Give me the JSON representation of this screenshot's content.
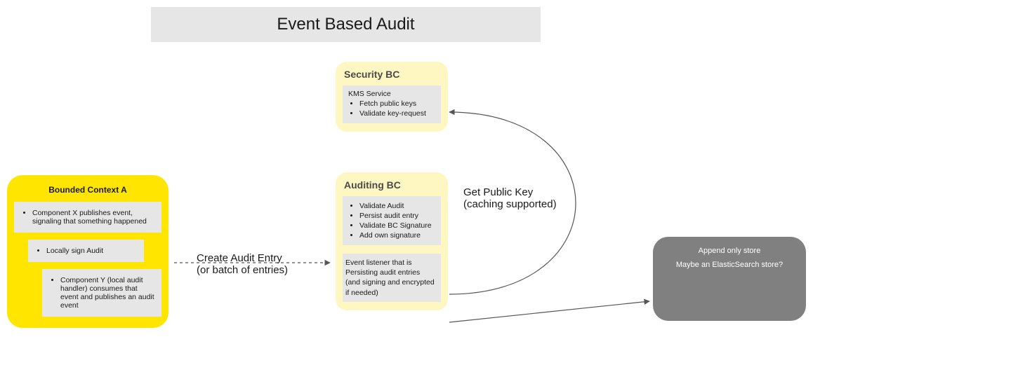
{
  "title": "Event Based Audit",
  "bounded_context_a": {
    "title": "Bounded Context A",
    "note1": "Component X publishes event, signaling that something happened",
    "note2": "Locally sign Audit",
    "note3": "Component Y (local audit handler) consumes that event and publishes an audit event"
  },
  "security_bc": {
    "title": "Security BC",
    "service_title": "KMS Service",
    "items": [
      "Fetch public keys",
      "Validate key-request"
    ]
  },
  "auditing_bc": {
    "title": "Auditing BC",
    "items": [
      "Validate Audit",
      "Persist audit entry",
      "Validate BC Signature",
      "Add own signature"
    ],
    "listener_l1": "Event listener that is",
    "listener_l2": "Persisting audit entries",
    "listener_l3": "(and signing and encrypted if needed)"
  },
  "store": {
    "l1": "Append only store",
    "l2": "Maybe an ElasticSearch store?"
  },
  "labels": {
    "create_l1": "Create Audit Entry",
    "create_l2": "(or batch of entries)",
    "getkey_l1": "Get Public Key",
    "getkey_l2": "(caching supported)"
  }
}
